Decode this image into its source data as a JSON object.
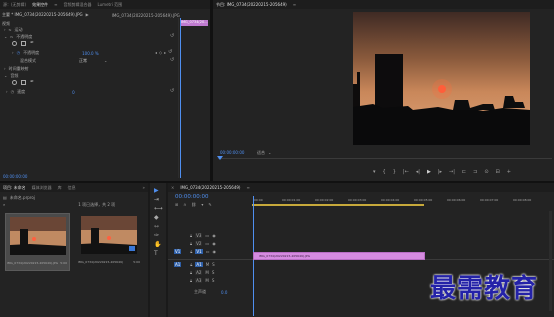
{
  "source": {
    "tab_active": "效果控件",
    "tab_lumetri": "Lumetri 范围",
    "tab_source": "源：(无剪辑)",
    "tab_mixer": "音频剪辑混合器",
    "menu_icon": "≡",
    "clip_path": "主要 * IMG_0734(20220215-205649).JPG",
    "clip_path2": "IMG_0734(20220215-205649).JPG",
    "mini_clip_label": "IMG_0734(20...",
    "video_label": "视频",
    "motion_label": "运动",
    "opacity_label": "不透明度",
    "opacity_param_label": "不透明度",
    "opacity_value": "100.0 %",
    "blend_label": "混合模式",
    "blend_value": "正常",
    "time_remap_label": "时间重映射",
    "audio_label": "音频",
    "speed_label": "速度",
    "speed_value": "0",
    "bottom_timecode": "00:00:00:00"
  },
  "program": {
    "title": "节目: IMG_0734(20220215-205649)",
    "timecode": "00:00:00:00",
    "fit_label": "适合",
    "transport": [
      "▾",
      "{",
      "}",
      "|←",
      "◂|",
      "▶",
      "|▸",
      "→|",
      "⊏",
      "⊐",
      "⊙",
      "⊟",
      "+"
    ]
  },
  "project": {
    "tab_active": "项目: 未命名",
    "tab_media": "媒体浏览器",
    "tab_libraries": "库",
    "tab_info": "信息",
    "project_file": "未命名.prproj",
    "selection_info": "1 项已选择，共 2 项",
    "items": [
      {
        "name": "IMG_0734(20220215-205649).JPG",
        "duration": "5:00"
      },
      {
        "name": "IMG_0734(20220215-205649)",
        "duration": "5:00"
      }
    ]
  },
  "timeline": {
    "title": "IMG_0734(20220215-205649)",
    "timecode": "00:00:00:00",
    "ruler": [
      "00:00",
      "00:00:01:00",
      "00:00:02:00",
      "00:00:03:00",
      "00:00:04:00",
      "00:00:05:00",
      "00:00:06:00",
      "00:00:07:00",
      "00:00:08:00"
    ],
    "video_tracks": [
      "V3",
      "V2",
      "V1"
    ],
    "audio_tracks": [
      "A1",
      "A2",
      "A3"
    ],
    "src_v": "V1",
    "src_a": "A1",
    "master_label": "主声道",
    "master_value": "0.0",
    "track_btns": {
      "m": "M",
      "s": "S"
    },
    "clip_label": "IMG_0734(20220215-205649).JPG",
    "clip_color": "#d58be0"
  },
  "tools": [
    "▶",
    "⇥",
    "⟷",
    "◆",
    "⇿",
    "✑",
    "✋",
    "T"
  ],
  "watermark": "最需教育",
  "colors": {
    "accent": "#4f8ff0",
    "clip": "#d58be0",
    "watermark": "#2422a8"
  }
}
